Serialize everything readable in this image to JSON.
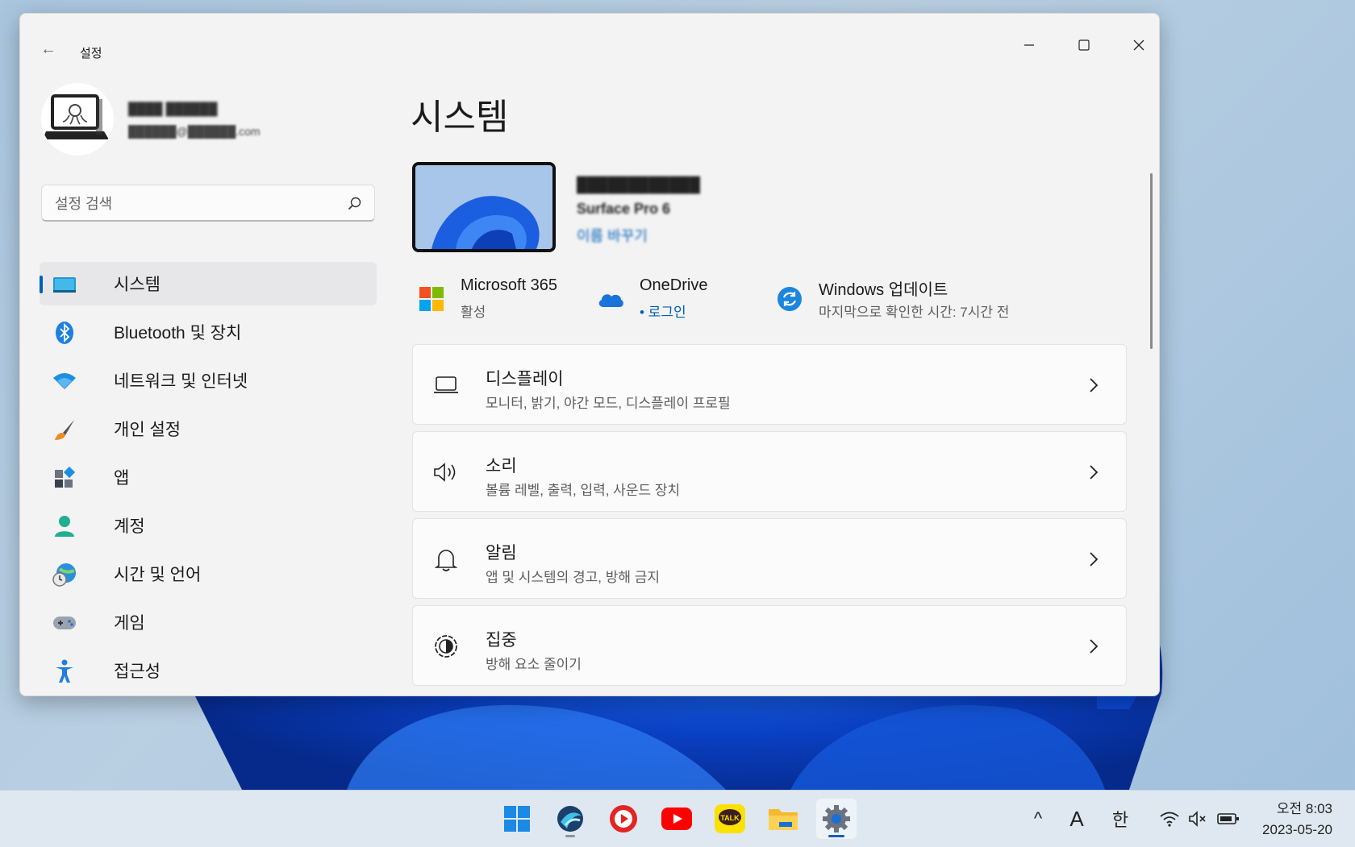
{
  "window": {
    "title": "설정",
    "back_label": "←"
  },
  "user": {
    "name": "████ ██████",
    "email": "██████@██████.com"
  },
  "search": {
    "placeholder": "설정 검색"
  },
  "sidebar": {
    "items": [
      {
        "label": "시스템",
        "icon": "monitor-icon",
        "active": true
      },
      {
        "label": "Bluetooth 및 장치",
        "icon": "bluetooth-icon",
        "active": false
      },
      {
        "label": "네트워크 및 인터넷",
        "icon": "wifi-icon",
        "active": false
      },
      {
        "label": "개인 설정",
        "icon": "brush-icon",
        "active": false
      },
      {
        "label": "앱",
        "icon": "apps-icon",
        "active": false
      },
      {
        "label": "계정",
        "icon": "person-icon",
        "active": false
      },
      {
        "label": "시간 및 언어",
        "icon": "globe-clock-icon",
        "active": false
      },
      {
        "label": "게임",
        "icon": "gamepad-icon",
        "active": false
      },
      {
        "label": "접근성",
        "icon": "accessibility-icon",
        "active": false
      }
    ]
  },
  "main": {
    "title": "시스템",
    "device": {
      "name": "████████████",
      "model": "Surface Pro 6",
      "rename": "이름 바꾸기"
    },
    "status": [
      {
        "title": "Microsoft 365",
        "sub": "활성",
        "icon": "microsoft-logo-icon"
      },
      {
        "title": "OneDrive",
        "sub": "• 로그인",
        "icon": "onedrive-cloud-icon"
      },
      {
        "title": "Windows 업데이트",
        "sub": "마지막으로 확인한 시간: 7시간 전",
        "icon": "windows-update-icon"
      }
    ],
    "cards": [
      {
        "title": "디스플레이",
        "sub": "모니터, 밝기, 야간 모드, 디스플레이 프로필",
        "icon": "laptop-icon"
      },
      {
        "title": "소리",
        "sub": "볼륨 레벨, 출력, 입력, 사운드 장치",
        "icon": "speaker-icon"
      },
      {
        "title": "알림",
        "sub": "앱 및 시스템의 경고, 방해 금지",
        "icon": "bell-icon"
      },
      {
        "title": "집중",
        "sub": "방해 요소 줄이기",
        "icon": "focus-icon"
      }
    ]
  },
  "taskbar": {
    "apps": [
      "start-icon",
      "browser-icon",
      "media-player-icon",
      "youtube-icon",
      "kakaotalk-icon",
      "file-explorer-icon",
      "settings-gear-icon"
    ],
    "kakao_label": "TALK",
    "tray": {
      "chevron": "^",
      "input_mode": "A",
      "ime": "한"
    },
    "clock": {
      "time": "오전 8:03",
      "date": "2023-05-20"
    }
  },
  "colors": {
    "accent": "#005fb8",
    "window_bg": "#f3f3f3",
    "card_bg": "#fbfbfb"
  }
}
